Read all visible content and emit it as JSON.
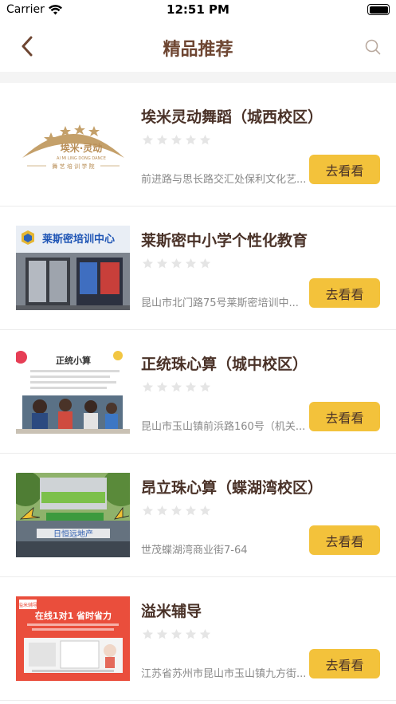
{
  "status_bar": {
    "carrier": "Carrier",
    "time": "12:51 PM",
    "battery_level": 1.0
  },
  "nav": {
    "title": "精品推荐",
    "back_icon": "chevron-left-icon",
    "search_icon": "search-icon"
  },
  "colors": {
    "accent": "#f3c23b",
    "title_text": "#6e4632",
    "item_title": "#4a3228",
    "star_empty": "#e5e5e5"
  },
  "items": [
    {
      "title": "埃米灵动舞蹈（城西校区）",
      "rating": 0,
      "address": "前进路与思长路交汇处保利文化艺...",
      "button": "去看看",
      "logo_text": {
        "main": "埃米·灵动",
        "sub": "AI MI LING DONG DANCE",
        "tag": "舞 艺 培 训 学 院"
      }
    },
    {
      "title": "莱斯密中小学个性化教育",
      "rating": 0,
      "address": "昆山市北门路75号莱斯密培训中...",
      "button": "去看看",
      "sign_text": "莱斯密培训中心"
    },
    {
      "title": "正统珠心算（城中校区）",
      "rating": 0,
      "address": "昆山市玉山镇前浜路160号（机关...",
      "button": "去看看",
      "banner_text": "正统小算"
    },
    {
      "title": "昂立珠心算（蝶湖湾校区）",
      "rating": 0,
      "address": "世茂蝶湖湾商业街7-64",
      "button": "去看看",
      "sign_text": "日恒远地产"
    },
    {
      "title": "溢米辅导",
      "rating": 0,
      "address": "江苏省苏州市昆山市玉山镇九方街...",
      "button": "去看看",
      "poster_text": {
        "brand": "溢米辅导",
        "headline": "在线1对1 省时省力"
      }
    }
  ]
}
